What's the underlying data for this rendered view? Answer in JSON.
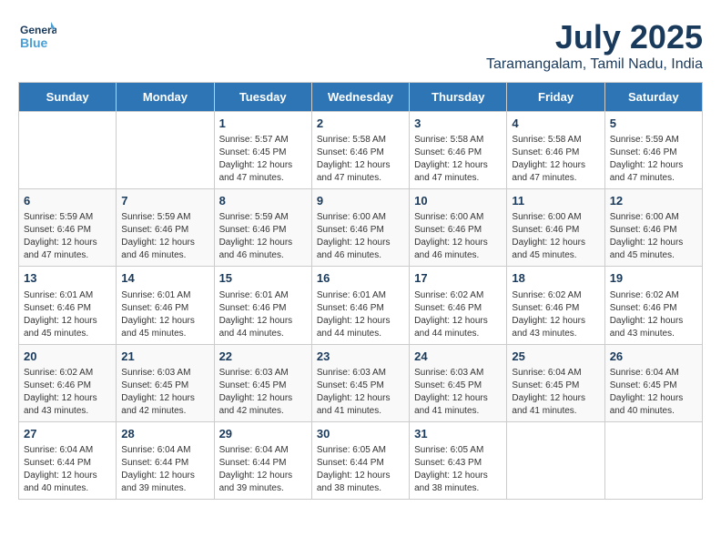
{
  "logo": {
    "line1": "General",
    "line2": "Blue"
  },
  "title": "July 2025",
  "subtitle": "Taramangalam, Tamil Nadu, India",
  "weekdays": [
    "Sunday",
    "Monday",
    "Tuesday",
    "Wednesday",
    "Thursday",
    "Friday",
    "Saturday"
  ],
  "weeks": [
    [
      {
        "day": "",
        "sunrise": "",
        "sunset": "",
        "daylight": ""
      },
      {
        "day": "",
        "sunrise": "",
        "sunset": "",
        "daylight": ""
      },
      {
        "day": "1",
        "sunrise": "Sunrise: 5:57 AM",
        "sunset": "Sunset: 6:45 PM",
        "daylight": "Daylight: 12 hours and 47 minutes."
      },
      {
        "day": "2",
        "sunrise": "Sunrise: 5:58 AM",
        "sunset": "Sunset: 6:46 PM",
        "daylight": "Daylight: 12 hours and 47 minutes."
      },
      {
        "day": "3",
        "sunrise": "Sunrise: 5:58 AM",
        "sunset": "Sunset: 6:46 PM",
        "daylight": "Daylight: 12 hours and 47 minutes."
      },
      {
        "day": "4",
        "sunrise": "Sunrise: 5:58 AM",
        "sunset": "Sunset: 6:46 PM",
        "daylight": "Daylight: 12 hours and 47 minutes."
      },
      {
        "day": "5",
        "sunrise": "Sunrise: 5:59 AM",
        "sunset": "Sunset: 6:46 PM",
        "daylight": "Daylight: 12 hours and 47 minutes."
      }
    ],
    [
      {
        "day": "6",
        "sunrise": "Sunrise: 5:59 AM",
        "sunset": "Sunset: 6:46 PM",
        "daylight": "Daylight: 12 hours and 47 minutes."
      },
      {
        "day": "7",
        "sunrise": "Sunrise: 5:59 AM",
        "sunset": "Sunset: 6:46 PM",
        "daylight": "Daylight: 12 hours and 46 minutes."
      },
      {
        "day": "8",
        "sunrise": "Sunrise: 5:59 AM",
        "sunset": "Sunset: 6:46 PM",
        "daylight": "Daylight: 12 hours and 46 minutes."
      },
      {
        "day": "9",
        "sunrise": "Sunrise: 6:00 AM",
        "sunset": "Sunset: 6:46 PM",
        "daylight": "Daylight: 12 hours and 46 minutes."
      },
      {
        "day": "10",
        "sunrise": "Sunrise: 6:00 AM",
        "sunset": "Sunset: 6:46 PM",
        "daylight": "Daylight: 12 hours and 46 minutes."
      },
      {
        "day": "11",
        "sunrise": "Sunrise: 6:00 AM",
        "sunset": "Sunset: 6:46 PM",
        "daylight": "Daylight: 12 hours and 45 minutes."
      },
      {
        "day": "12",
        "sunrise": "Sunrise: 6:00 AM",
        "sunset": "Sunset: 6:46 PM",
        "daylight": "Daylight: 12 hours and 45 minutes."
      }
    ],
    [
      {
        "day": "13",
        "sunrise": "Sunrise: 6:01 AM",
        "sunset": "Sunset: 6:46 PM",
        "daylight": "Daylight: 12 hours and 45 minutes."
      },
      {
        "day": "14",
        "sunrise": "Sunrise: 6:01 AM",
        "sunset": "Sunset: 6:46 PM",
        "daylight": "Daylight: 12 hours and 45 minutes."
      },
      {
        "day": "15",
        "sunrise": "Sunrise: 6:01 AM",
        "sunset": "Sunset: 6:46 PM",
        "daylight": "Daylight: 12 hours and 44 minutes."
      },
      {
        "day": "16",
        "sunrise": "Sunrise: 6:01 AM",
        "sunset": "Sunset: 6:46 PM",
        "daylight": "Daylight: 12 hours and 44 minutes."
      },
      {
        "day": "17",
        "sunrise": "Sunrise: 6:02 AM",
        "sunset": "Sunset: 6:46 PM",
        "daylight": "Daylight: 12 hours and 44 minutes."
      },
      {
        "day": "18",
        "sunrise": "Sunrise: 6:02 AM",
        "sunset": "Sunset: 6:46 PM",
        "daylight": "Daylight: 12 hours and 43 minutes."
      },
      {
        "day": "19",
        "sunrise": "Sunrise: 6:02 AM",
        "sunset": "Sunset: 6:46 PM",
        "daylight": "Daylight: 12 hours and 43 minutes."
      }
    ],
    [
      {
        "day": "20",
        "sunrise": "Sunrise: 6:02 AM",
        "sunset": "Sunset: 6:46 PM",
        "daylight": "Daylight: 12 hours and 43 minutes."
      },
      {
        "day": "21",
        "sunrise": "Sunrise: 6:03 AM",
        "sunset": "Sunset: 6:45 PM",
        "daylight": "Daylight: 12 hours and 42 minutes."
      },
      {
        "day": "22",
        "sunrise": "Sunrise: 6:03 AM",
        "sunset": "Sunset: 6:45 PM",
        "daylight": "Daylight: 12 hours and 42 minutes."
      },
      {
        "day": "23",
        "sunrise": "Sunrise: 6:03 AM",
        "sunset": "Sunset: 6:45 PM",
        "daylight": "Daylight: 12 hours and 41 minutes."
      },
      {
        "day": "24",
        "sunrise": "Sunrise: 6:03 AM",
        "sunset": "Sunset: 6:45 PM",
        "daylight": "Daylight: 12 hours and 41 minutes."
      },
      {
        "day": "25",
        "sunrise": "Sunrise: 6:04 AM",
        "sunset": "Sunset: 6:45 PM",
        "daylight": "Daylight: 12 hours and 41 minutes."
      },
      {
        "day": "26",
        "sunrise": "Sunrise: 6:04 AM",
        "sunset": "Sunset: 6:45 PM",
        "daylight": "Daylight: 12 hours and 40 minutes."
      }
    ],
    [
      {
        "day": "27",
        "sunrise": "Sunrise: 6:04 AM",
        "sunset": "Sunset: 6:44 PM",
        "daylight": "Daylight: 12 hours and 40 minutes."
      },
      {
        "day": "28",
        "sunrise": "Sunrise: 6:04 AM",
        "sunset": "Sunset: 6:44 PM",
        "daylight": "Daylight: 12 hours and 39 minutes."
      },
      {
        "day": "29",
        "sunrise": "Sunrise: 6:04 AM",
        "sunset": "Sunset: 6:44 PM",
        "daylight": "Daylight: 12 hours and 39 minutes."
      },
      {
        "day": "30",
        "sunrise": "Sunrise: 6:05 AM",
        "sunset": "Sunset: 6:44 PM",
        "daylight": "Daylight: 12 hours and 38 minutes."
      },
      {
        "day": "31",
        "sunrise": "Sunrise: 6:05 AM",
        "sunset": "Sunset: 6:43 PM",
        "daylight": "Daylight: 12 hours and 38 minutes."
      },
      {
        "day": "",
        "sunrise": "",
        "sunset": "",
        "daylight": ""
      },
      {
        "day": "",
        "sunrise": "",
        "sunset": "",
        "daylight": ""
      }
    ]
  ]
}
